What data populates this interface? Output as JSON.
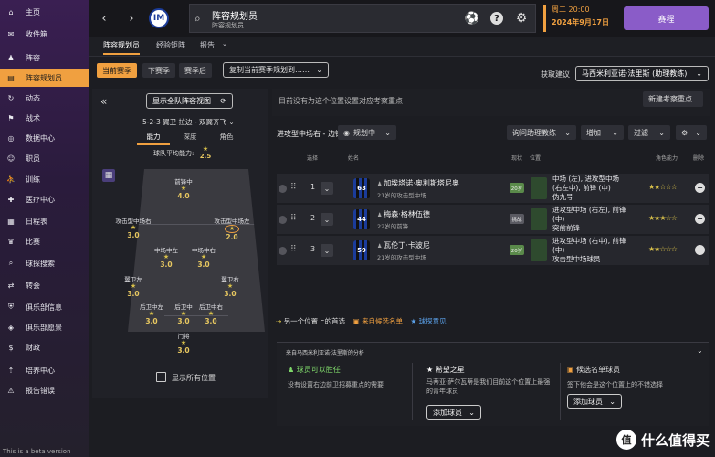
{
  "sidebar": {
    "items": [
      {
        "label": "主页",
        "icon": "home-icon"
      },
      {
        "label": "收件箱",
        "icon": "inbox-icon"
      },
      {
        "label": "阵容",
        "icon": "squad-icon"
      },
      {
        "label": "阵容规划员",
        "icon": "planner-icon"
      },
      {
        "label": "动态",
        "icon": "dynamics-icon"
      },
      {
        "label": "战术",
        "icon": "tactics-icon"
      },
      {
        "label": "数据中心",
        "icon": "data-hub-icon"
      },
      {
        "label": "职员",
        "icon": "staff-icon"
      },
      {
        "label": "训练",
        "icon": "training-icon"
      },
      {
        "label": "医疗中心",
        "icon": "medical-icon"
      },
      {
        "label": "日程表",
        "icon": "calendar-icon"
      },
      {
        "label": "比赛",
        "icon": "trophy-icon"
      },
      {
        "label": "球探搜索",
        "icon": "scouting-icon"
      },
      {
        "label": "转会",
        "icon": "transfers-icon"
      },
      {
        "label": "俱乐部信息",
        "icon": "club-info-icon"
      },
      {
        "label": "俱乐部愿景",
        "icon": "club-vision-icon"
      },
      {
        "label": "财政",
        "icon": "finances-icon"
      },
      {
        "label": "培养中心",
        "icon": "development-icon"
      },
      {
        "label": "报告错误",
        "icon": "report-bug-icon"
      }
    ],
    "active_index": 3,
    "beta_text": "This is a beta version"
  },
  "header": {
    "title": "阵容规划员",
    "subtitle": "阵容规划员",
    "date_line1": "周二 20:00",
    "date_line2": "2024年9月17日",
    "continue_label": "赛程"
  },
  "tabs": [
    "阵容规划员",
    "经验矩阵",
    "报告"
  ],
  "season_tabs": [
    "当前赛季",
    "下赛季",
    "赛季后"
  ],
  "copy_button": "复制当前赛季规划到……",
  "advice_label": "获取建议",
  "advisor": "马西米利亚诺·法里斯 (助理教练)",
  "left_panel": {
    "show_squad_view": "显示全队阵容视图",
    "formation": "5-2-3 翼卫 拉边 - 双翼齐飞",
    "tabs": [
      "能力",
      "深度",
      "角色"
    ],
    "team_avg_label": "球队平均能力:",
    "team_avg_value": "2.5",
    "show_all_label": "显示所有位置",
    "positions": [
      {
        "label": "前锋中",
        "value": "4.0"
      },
      {
        "label": "攻击型中场右",
        "value": "3.0"
      },
      {
        "label": "攻击型中场左",
        "value": "2.0"
      },
      {
        "label": "中场中左",
        "value": "3.0"
      },
      {
        "label": "中场中右",
        "value": "3.0"
      },
      {
        "label": "翼卫左",
        "value": "3.0"
      },
      {
        "label": "翼卫右",
        "value": "3.0"
      },
      {
        "label": "后卫中左",
        "value": "3.0"
      },
      {
        "label": "后卫中",
        "value": "3.0"
      },
      {
        "label": "后卫中右",
        "value": "3.0"
      },
      {
        "label": "门将",
        "value": "3.0"
      }
    ]
  },
  "right_panel": {
    "notice": "目前没有为这个位置设置对应考察重点",
    "new_focus_button": "新建考察重点",
    "position_title": "进攻型中场右 - 边锋",
    "plan_button": "规划中",
    "consult_button": "询问助理教练",
    "add_button": "增加",
    "filter_button": "过滤",
    "col_select": "选择",
    "col_name": "姓名",
    "col_status": "现状",
    "col_position": "位置",
    "col_role": "角色能力",
    "col_delete": "删除",
    "players": [
      {
        "order": "1",
        "shirt": "63",
        "name": "加埃塔诺·奥利斯塔尼奥",
        "age": "21岁的攻击型中场",
        "status": "20岁",
        "pos_lines": [
          "中场 (左), 进攻型中场",
          "(右左中), 前锋 (中)",
          "伪九号"
        ],
        "stars": "★★☆☆☆"
      },
      {
        "order": "2",
        "shirt": "44",
        "name": "梅森·格林伍德",
        "age": "22岁的前锋",
        "status": "挑战",
        "pos_lines": [
          "进攻型中场 (右左), 前锋",
          "(中)",
          "突前前锋"
        ],
        "stars": "★★★☆☆"
      },
      {
        "order": "3",
        "shirt": "59",
        "name": "瓦伦丁·卡波尼",
        "age": "21岁的攻击型中场",
        "status": "20岁",
        "pos_lines": [
          "进攻型中场 (右中), 前锋",
          "(中)",
          "攻击型中场球员"
        ],
        "stars": "★★☆☆☆"
      }
    ],
    "another_priority": "另一个位置上的首选",
    "from_shortlist": "来自候选名单",
    "scout_opinion": "球探意见"
  },
  "analysis": {
    "title": "来自马西米利亚诺·法里斯的分析",
    "col1_title": "球员可以胜任",
    "col1_text": "没有设置右边前卫招募重点的需要",
    "col2_title": "希望之星",
    "col2_text": "马蒂亚·萨尔瓦蒂是我们目前这个位置上最强的青年球员",
    "col2_button": "添加球员",
    "col3_title": "候选名单球员",
    "col3_text": "签下他会是这个位置上的不错选择",
    "col3_button": "添加球员"
  },
  "watermark": "什么值得买",
  "colors": {
    "accent": "#f0a040",
    "brand": "#8a5cc8"
  }
}
